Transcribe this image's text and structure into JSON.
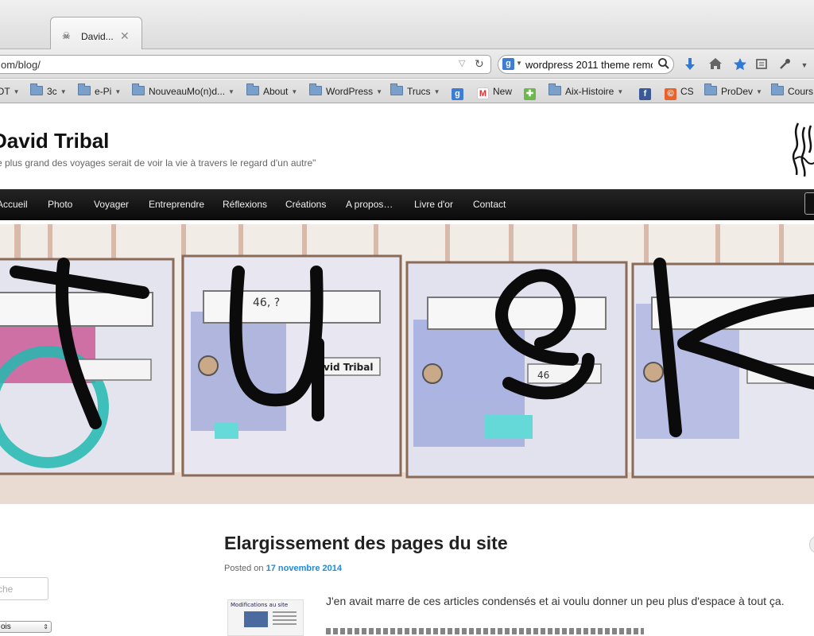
{
  "browser": {
    "tab_title": "David...",
    "tab_close": "✕",
    "url": "om/blog/",
    "search_query": "wordpress 2011 theme remo",
    "search_engine_glyph": "g"
  },
  "bookmarks": [
    {
      "label": "OT",
      "type": "folder"
    },
    {
      "label": "3c",
      "type": "folder"
    },
    {
      "label": "e-Pi",
      "type": "folder"
    },
    {
      "label": "NouveauMo(n)d...",
      "type": "folder"
    },
    {
      "label": "About",
      "type": "folder"
    },
    {
      "label": "WordPress",
      "type": "folder"
    },
    {
      "label": "Trucs",
      "type": "folder"
    },
    {
      "label": "",
      "type": "google-icon"
    },
    {
      "label": "New",
      "type": "gmail-icon"
    },
    {
      "label": "",
      "type": "google-maps-icon"
    },
    {
      "label": "Aix-Histoire",
      "type": "folder"
    },
    {
      "label": "",
      "type": "facebook-icon"
    },
    {
      "label": "CS",
      "type": "couchsurfing-icon"
    },
    {
      "label": "ProDev",
      "type": "folder"
    },
    {
      "label": "Cours",
      "type": "folder"
    }
  ],
  "site": {
    "title": "David Tribal",
    "description": "e plus grand des voyages serait de voir la vie à travers le regard d'un autre\""
  },
  "menu": [
    "Accueil",
    "Photo",
    "Voyager",
    "Entreprendre",
    "Réflexions",
    "Créations",
    "A propos…",
    "Livre d'or",
    "Contact"
  ],
  "header_image": {
    "mailbox_labels": [
      "46, ?",
      "David Tribal",
      "46"
    ]
  },
  "post": {
    "title": "Elargissement des pages du site",
    "posted_on": "Posted on",
    "date": "17 novembre 2014",
    "excerpt": "J'en avait marre de ces articles condensés et ai voulu donner un peu plus d'espace à tout ça.",
    "thumbnail_caption": "Modifications au site"
  },
  "sidebar": {
    "search_placeholder": "che",
    "select_value": "ois"
  },
  "colors": {
    "menu_bg": "#111111",
    "link": "#1b8be0"
  }
}
